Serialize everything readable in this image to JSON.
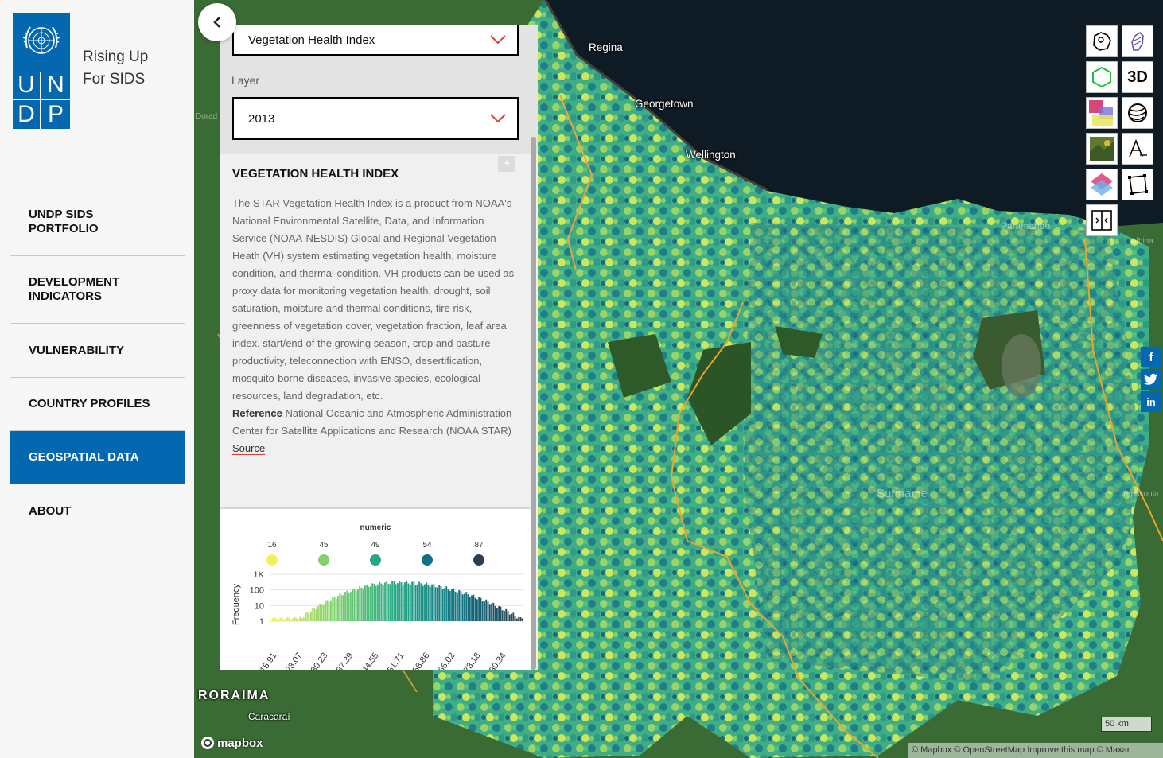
{
  "brand": {
    "line1": "Rising Up",
    "line2": "For SIDS",
    "logo_letters": [
      "U",
      "N",
      "D",
      "P"
    ]
  },
  "nav": [
    {
      "label": "UNDP SIDS\nPORTFOLIO",
      "active": false
    },
    {
      "label": "DEVELOPMENT\nINDICATORS",
      "active": false
    },
    {
      "label": "VULNERABILITY",
      "active": false
    },
    {
      "label": "COUNTRY PROFILES",
      "active": false
    },
    {
      "label": "GEOSPATIAL DATA",
      "active": true
    },
    {
      "label": "ABOUT",
      "active": false
    }
  ],
  "panel": {
    "dataset_value": "Vegetation Health Index",
    "layer_label": "Layer",
    "layer_value": "2013",
    "title": "VEGETATION HEALTH INDEX",
    "plus": "+",
    "description": "The STAR Vegetation Health Index is a product from NOAA's National Environmental Satellite, Data, and Information Service (NOAA-NESDIS) Global and Regional Vegetation Heath (VH) system estimating vegetation health, moisture condition, and thermal condition. VH products can be used as proxy data for monitoring vegetation health, drought, soil saturation, moisture and thermal conditions, fire risk, greenness of vegetation cover, vegetation fraction, leaf area index, start/end of the growing season, crop and pasture productivity, teleconnection with ENSO, desertification, mosquito-borne diseases, invasive species, ecological resources, land degradation, etc.",
    "reference_label": "Reference",
    "reference_text": "National Oceanic and Atmospheric Administration Center for Satellite Applications and Research (NOAA STAR)",
    "source_link": "Source"
  },
  "legend": {
    "title": "numeric",
    "stops": [
      {
        "label": "16",
        "color": "#f2ef5a"
      },
      {
        "label": "45",
        "color": "#7fd26b"
      },
      {
        "label": "49",
        "color": "#26a886"
      },
      {
        "label": "54",
        "color": "#0f7383"
      },
      {
        "label": "87",
        "color": "#2c3e50"
      }
    ]
  },
  "chart_data": {
    "type": "bar",
    "title": "numeric",
    "ylabel": "Frequency",
    "y_scale": "log",
    "y_ticks": [
      "1K",
      "100",
      "10",
      "1"
    ],
    "x_ticks": [
      "15.91",
      "23.07",
      "30.23",
      "37.39",
      "44.55",
      "51.71",
      "58.86",
      "66.02",
      "73.18",
      "80.34"
    ],
    "xlim": [
      15.91,
      87
    ],
    "ylim": [
      1,
      1000
    ],
    "peak": {
      "x": 51.71,
      "y": 300
    }
  },
  "map": {
    "places": [
      "Regina",
      "Georgetown",
      "Wellington",
      "Paramaribo",
      "RORAIMA",
      "Caracaraí",
      "Suriname",
      "Dorad",
      "Ripasoula",
      "Albina"
    ],
    "scale": "50 km",
    "attribution": "© Mapbox © OpenStreetMap  Improve this map © Maxar",
    "mapbox_logo": "mapbox"
  },
  "tools": [
    {
      "icon": "region-select-icon"
    },
    {
      "icon": "country-outline-icon"
    },
    {
      "icon": "hexagon-icon"
    },
    {
      "label": "3D"
    },
    {
      "icon": "layers-color-icon"
    },
    {
      "icon": "globe-icon"
    },
    {
      "icon": "satellite-icon"
    },
    {
      "icon": "text-label-icon"
    },
    {
      "icon": "stack-layers-icon"
    },
    {
      "icon": "polygon-draw-icon"
    },
    {
      "icon": "compare-split-icon"
    }
  ],
  "share": [
    "f",
    "t",
    "in"
  ]
}
